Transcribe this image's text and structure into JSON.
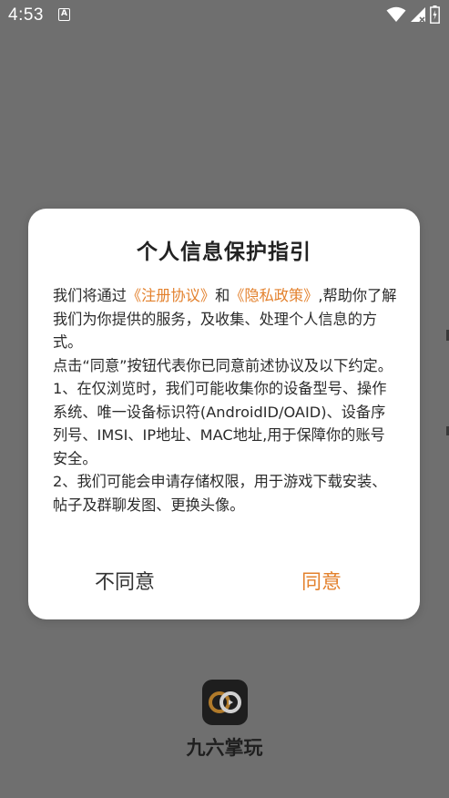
{
  "status_bar": {
    "time": "4:53",
    "notification_letter": "A"
  },
  "app": {
    "name": "九六掌玩"
  },
  "dialog": {
    "title": "个人信息保护指引",
    "intro_prefix": "我们将通过",
    "link_terms": "《注册协议》",
    "intro_and": "和",
    "link_privacy": "《隐私政策》",
    "intro_suffix": ",帮助你了解我们为你提供的服务，及收集、处理个人信息的方式。",
    "paragraph_2": "点击“同意”按钮代表你已同意前述协议及以下约定。",
    "paragraph_3": "1、在仅浏览时，我们可能收集你的设备型号、操作系统、唯一设备标识符(AndroidID/OAID)、设备序列号、IMSI、IP地址、MAC地址,用于保障你的账号安全。",
    "paragraph_4": "2、我们可能会申请存储权限，用于游戏下载安装、帖子及群聊发图、更换头像。",
    "disagree_label": "不同意",
    "agree_label": "同意"
  },
  "colors": {
    "accent": "#e3812d",
    "overlay_background": "#6f6f6f",
    "dialog_background": "#ffffff"
  }
}
